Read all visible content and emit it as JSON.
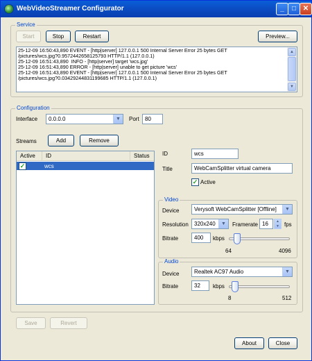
{
  "window": {
    "title": "WebVideoStreamer Configurator"
  },
  "service": {
    "label": "Service",
    "start": "Start",
    "stop": "Stop",
    "restart": "Restart",
    "preview": "Preview...",
    "log": [
      "25-12-09 16:50:43,890 EVENT - [http|server] 127.0.0.1 500 Internal Server Error 25 bytes GET",
      "/pictures/wcs.jpg?0.9572442658125793 HTTP/1.1 (127.0.0.1)",
      "25-12-09 16:51:43,890  INFO - [http|server] target 'wcs.jpg'",
      "25-12-09 16:51:43,890 ERROR - [http|server] unable to get picture 'wcs'",
      "25-12-09 16:51:43,890 EVENT - [http|server] 127.0.0.1 500 Internal Server Error 25 bytes GET",
      "/pictures/wcs.jpg?0.03429244831199685 HTTP/1.1 (127.0.0.1)"
    ]
  },
  "configuration": {
    "label": "Configuration",
    "interface_label": "Interface",
    "interface_value": "0.0.0.0",
    "port_label": "Port",
    "port_value": "80",
    "streams_label": "Streams",
    "add": "Add",
    "remove": "Remove",
    "columns": {
      "active": "Active",
      "id": "ID",
      "status": "Status"
    },
    "rows": [
      {
        "active": true,
        "id": "wcs",
        "status": ""
      }
    ]
  },
  "detail": {
    "id_label": "ID",
    "id_value": "wcs",
    "title_label": "Title",
    "title_value": "WebCamSplitter virtual camera",
    "active_label": "Active",
    "active_checked": true
  },
  "video": {
    "label": "Video",
    "device_label": "Device",
    "device_value": "Verysoft WebCamSplitter [Offline]",
    "resolution_label": "Resolution",
    "resolution_value": "320x240",
    "framerate_label": "Framerate",
    "framerate_value": "16",
    "fps": "fps",
    "bitrate_label": "Bitrate",
    "bitrate_value": "400",
    "kbps": "kbps",
    "bitrate_min": "64",
    "bitrate_max": "4096",
    "bitrate_level": 0.08
  },
  "audio": {
    "label": "Audio",
    "device_label": "Device",
    "device_value": "Realtek AC97 Audio",
    "bitrate_label": "Bitrate",
    "bitrate_value": "32",
    "kbps": "kbps",
    "bitrate_min": "8",
    "bitrate_max": "512",
    "bitrate_level": 0.05
  },
  "footer": {
    "save": "Save",
    "revert": "Revert",
    "about": "About",
    "close": "Close"
  }
}
